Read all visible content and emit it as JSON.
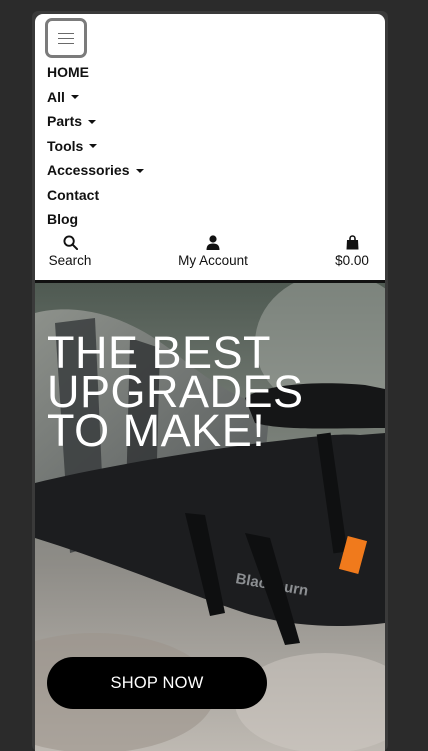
{
  "nav": {
    "items": [
      {
        "label": "HOME",
        "dropdown": false
      },
      {
        "label": "All",
        "dropdown": true
      },
      {
        "label": "Parts",
        "dropdown": true
      },
      {
        "label": "Tools",
        "dropdown": true
      },
      {
        "label": "Accessories",
        "dropdown": true
      },
      {
        "label": "Contact",
        "dropdown": false
      },
      {
        "label": "Blog",
        "dropdown": false
      }
    ]
  },
  "toolbar": {
    "search": {
      "label": "Search",
      "icon": "search-icon"
    },
    "account": {
      "label": "My Account",
      "icon": "user-icon"
    },
    "cart": {
      "label": "$0.00",
      "icon": "shopping-bag-icon"
    }
  },
  "hero": {
    "headline": "THE BEST UPGRADES TO MAKE!",
    "cta_label": "SHOP NOW",
    "bag_brand_text": "Blackburn"
  },
  "colors": {
    "background": "#2b2b2b",
    "card": "#ffffff",
    "cta": "#000000",
    "accent_tab": "#f07a1c"
  }
}
